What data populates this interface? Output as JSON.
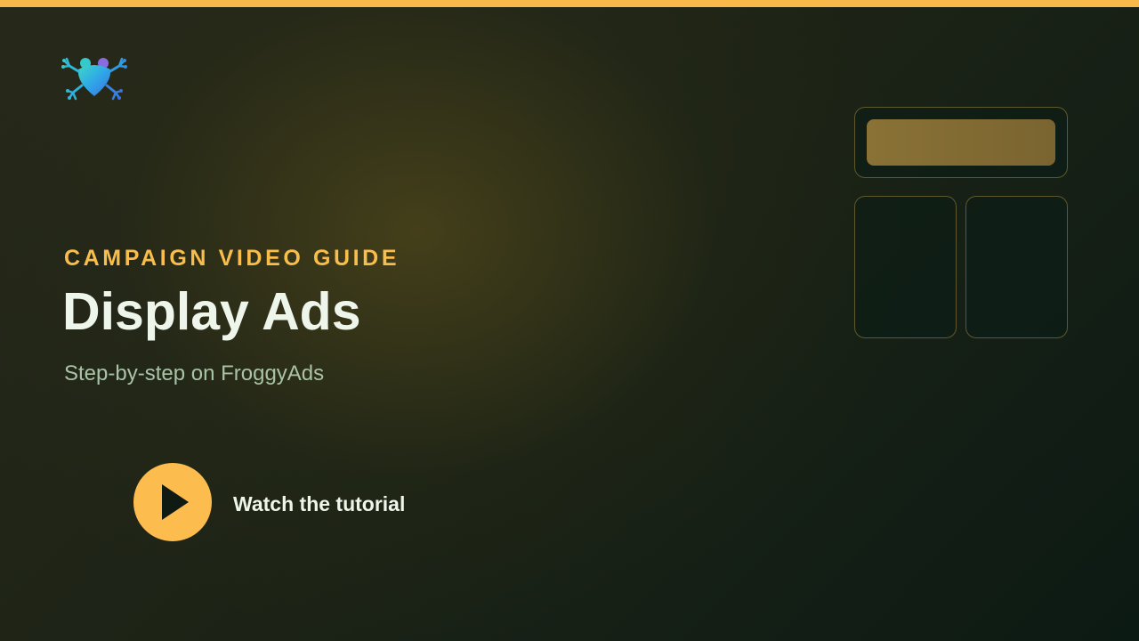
{
  "brand": {
    "logo_icon": "frog-logo-icon",
    "accent_color": "#f8b84a"
  },
  "hero": {
    "eyebrow": "CAMPAIGN VIDEO GUIDE",
    "title": "Display Ads",
    "subtitle": "Step-by-step on FroggyAds"
  },
  "cta": {
    "icon": "play-icon",
    "label": "Watch the tutorial"
  },
  "illustration": {
    "icon": "display-ad-layout-icon"
  }
}
